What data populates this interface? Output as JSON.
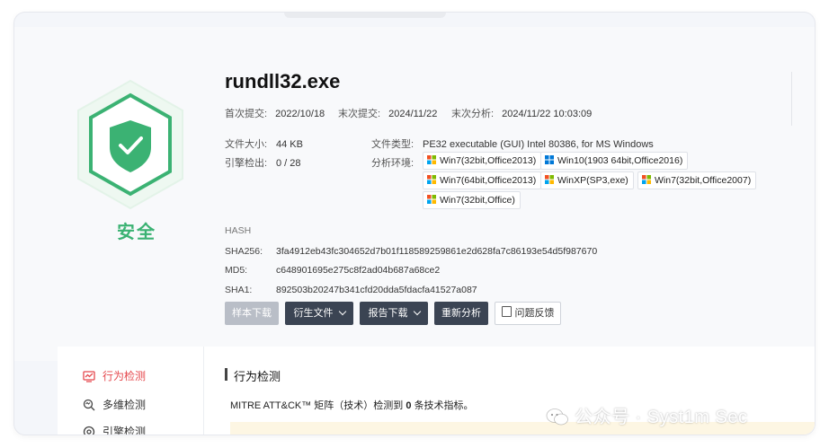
{
  "file": {
    "name": "rundll32.exe",
    "status": "安全",
    "first_submit_label": "首次提交:",
    "first_submit": "2022/10/18",
    "last_submit_label": "末次提交:",
    "last_submit": "2024/11/22",
    "last_analysis_label": "末次分析:",
    "last_analysis": "2024/11/22 10:03:09",
    "size_label": "文件大小:",
    "size": "44 KB",
    "engine_label": "引擎检出:",
    "engine": "0 / 28",
    "type_label": "文件类型:",
    "type": "PE32 executable (GUI) Intel 80386, for MS Windows",
    "env_label": "分析环境:"
  },
  "environments": [
    {
      "label": "Win7(32bit,Office2013)",
      "icon": "windows-flag-icon"
    },
    {
      "label": "Win10(1903 64bit,Office2016)",
      "icon": "windows10-icon"
    },
    {
      "label": "Win7(64bit,Office2013)",
      "icon": "windows-flag-icon"
    },
    {
      "label": "WinXP(SP3,exe)",
      "icon": "windows-flag-icon"
    },
    {
      "label": "Win7(32bit,Office2007)",
      "icon": "windows-flag-icon"
    },
    {
      "label": "Win7(32bit,Office)",
      "icon": "windows-flag-icon"
    }
  ],
  "hash": {
    "title": "HASH",
    "sha256_label": "SHA256:",
    "sha256": "3fa4912eb43fc304652d7b01f118589259861e2d628fa7c86193e54d5f987670",
    "md5_label": "MD5:",
    "md5": "c648901695e275c8f2ad04b687a68ce2",
    "sha1_label": "SHA1:",
    "sha1": "892503b20247b341cfd20dda5fdacfa41527a087"
  },
  "actions": {
    "sample_download": "样本下载",
    "derived_files": "衍生文件",
    "report_download": "报告下载",
    "reanalyze": "重新分析",
    "feedback": "问题反馈"
  },
  "sidebar": {
    "items": [
      {
        "label": "行为检测",
        "icon": "behavior-detect-icon",
        "active": true
      },
      {
        "label": "多维检测",
        "icon": "multi-detect-icon",
        "active": false
      },
      {
        "label": "引擎检测",
        "icon": "engine-detect-icon",
        "active": false
      }
    ]
  },
  "section": {
    "title": "行为检测",
    "desc_prefix": "MITRE ATT&CK™ 矩阵（技术）检测到",
    "desc_count": "0",
    "desc_suffix": "条技术指标。"
  },
  "watermark": {
    "text": "公众号 · Syst1m Sec"
  },
  "colors": {
    "safe_green": "#3bb273",
    "active_red": "#e5484d",
    "dark_button": "#3b4453"
  }
}
